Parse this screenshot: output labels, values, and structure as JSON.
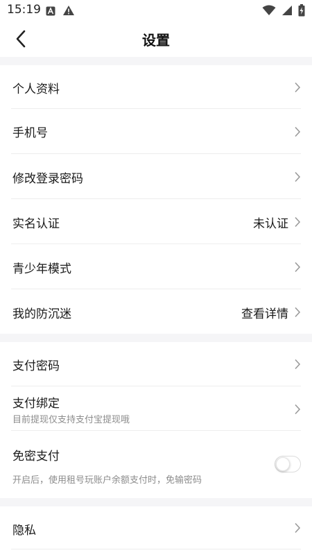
{
  "status_bar": {
    "time": "15:19",
    "left_icons": [
      "app-a-icon",
      "warning-icon"
    ],
    "right_icons": [
      "wifi-icon",
      "signal-icon",
      "battery-charging-icon"
    ]
  },
  "header": {
    "title": "设置",
    "back_icon": "chevron-left-icon"
  },
  "sections": [
    {
      "items": [
        {
          "label": "个人资料"
        },
        {
          "label": "手机号"
        },
        {
          "label": "修改登录密码"
        },
        {
          "label": "实名认证",
          "value": "未认证"
        },
        {
          "label": "青少年模式"
        },
        {
          "label": "我的防沉迷",
          "value": "查看详情"
        }
      ]
    },
    {
      "items": [
        {
          "label": "支付密码"
        },
        {
          "label": "支付绑定",
          "sub": "目前提现仅支持支付宝提现哦"
        },
        {
          "label": "免密支付",
          "sub": "开启后，使用租号玩账户余额支付时，免输密码",
          "toggle": false
        }
      ]
    },
    {
      "items": [
        {
          "label": "隐私"
        }
      ]
    }
  ],
  "colors": {
    "background": "#ffffff",
    "section_gap": "#f5f5f7",
    "text_primary": "#1a1a1a",
    "text_secondary": "#8c8c8c",
    "chevron": "#9a9a9a",
    "divider": "#ededed"
  }
}
